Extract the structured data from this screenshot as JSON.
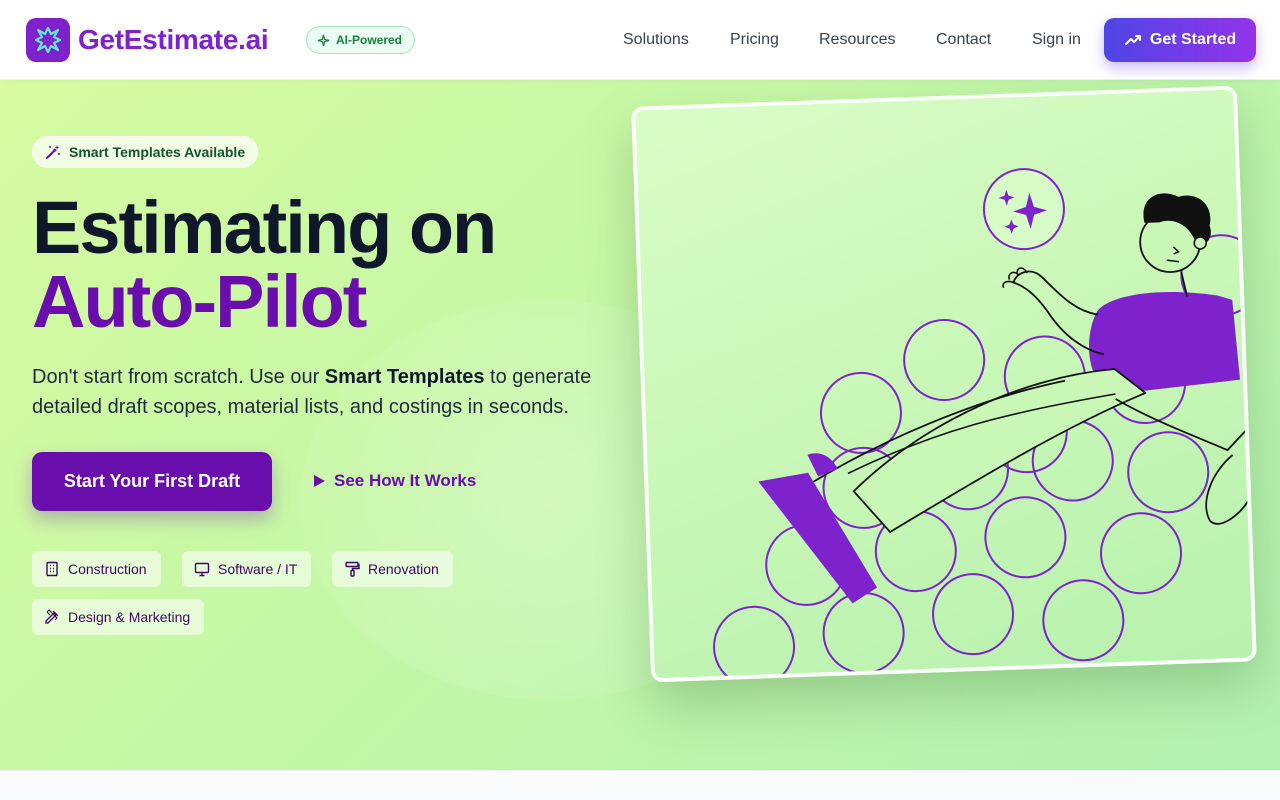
{
  "brand": {
    "name": "GetEstimate.ai",
    "badge": "AI-Powered",
    "logo_icon": "sparkle-star-icon"
  },
  "nav": {
    "items": [
      {
        "label": "Solutions"
      },
      {
        "label": "Pricing"
      },
      {
        "label": "Resources"
      },
      {
        "label": "Contact"
      },
      {
        "label": "Sign in"
      }
    ],
    "cta_label": "Get Started"
  },
  "hero": {
    "badge": "Smart Templates Available",
    "title_line1": "Estimating on",
    "title_line2": "Auto-Pilot",
    "subtitle_part1": "Don't start from scratch. Use our ",
    "subtitle_bold": "Smart Templates",
    "subtitle_part2": " to generate detailed draft scopes, material lists, and costings in seconds.",
    "primary_cta": "Start Your First Draft",
    "secondary_cta": "See How It Works",
    "industries": [
      {
        "label": "Construction",
        "icon": "building-icon"
      },
      {
        "label": "Software / IT",
        "icon": "monitor-icon"
      },
      {
        "label": "Renovation",
        "icon": "paint-roller-icon"
      },
      {
        "label": "Design & Marketing",
        "icon": "pencil-ruler-icon"
      }
    ]
  },
  "colors": {
    "brand_purple": "#6a0dad",
    "cta_gradient_start": "#4f46e5",
    "cta_gradient_end": "#9333ea",
    "hero_bg": "#c8f7a8"
  }
}
